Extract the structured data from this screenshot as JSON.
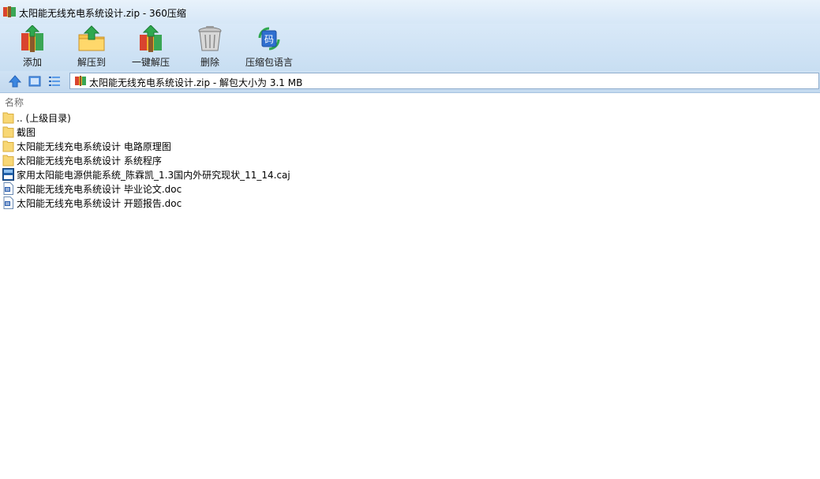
{
  "window": {
    "title": "太阳能无线充电系统设计.zip - 360压缩"
  },
  "toolbar": {
    "buttons": [
      {
        "label": "添加",
        "icon": "add-archive-icon"
      },
      {
        "label": "解压到",
        "icon": "extract-to-icon"
      },
      {
        "label": "一键解压",
        "icon": "one-click-extract-icon"
      },
      {
        "label": "删除",
        "icon": "trash-icon"
      },
      {
        "label": "压缩包语言",
        "icon": "archive-language-icon"
      }
    ]
  },
  "navbar": {
    "address": "太阳能无线充电系统设计.zip - 解包大小为 3.1 MB"
  },
  "list": {
    "column_name": "名称",
    "items": [
      {
        "name": ".. (上级目录)",
        "type": "folder"
      },
      {
        "name": "截图",
        "type": "folder"
      },
      {
        "name": "太阳能无线充电系统设计 电路原理图",
        "type": "folder"
      },
      {
        "name": "太阳能无线充电系统设计 系统程序",
        "type": "folder"
      },
      {
        "name": "家用太阳能电源供能系统_陈霖凯_1.3国内外研究现状_11_14.caj",
        "type": "caj"
      },
      {
        "name": "太阳能无线充电系统设计 毕业论文.doc",
        "type": "doc"
      },
      {
        "name": "太阳能无线充电系统设计 开题报告.doc",
        "type": "doc"
      }
    ]
  }
}
